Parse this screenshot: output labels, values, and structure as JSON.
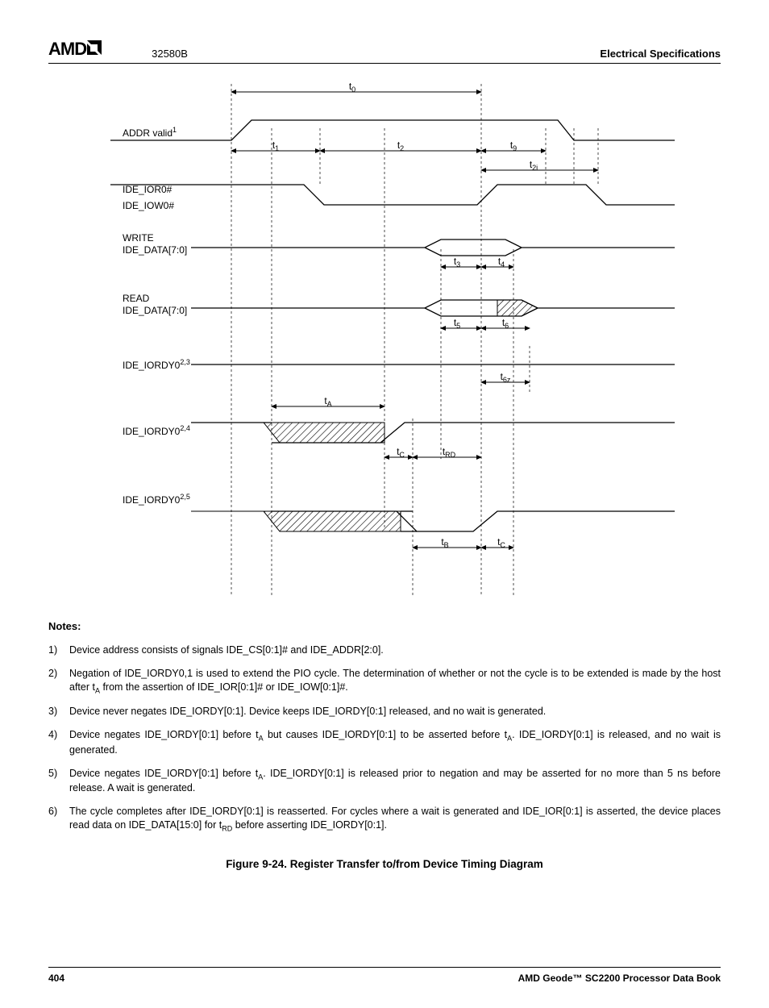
{
  "header": {
    "logo_text": "AMD",
    "doc_id": "32580B",
    "section": "Electrical Specifications"
  },
  "diagram": {
    "signals": {
      "addr": "ADDR valid",
      "addr_sup": "1",
      "ior": "IDE_IOR0#",
      "iow": "IDE_IOW0#",
      "write": "WRITE",
      "write_data": "IDE_DATA[7:0]",
      "read": "READ",
      "read_data": "IDE_DATA[7:0]",
      "iordy1": "IDE_IORDY0",
      "iordy1_sup": "2,3",
      "iordy2": "IDE_IORDY0",
      "iordy2_sup": "2,4",
      "iordy3": "IDE_IORDY0",
      "iordy3_sup": "2,5"
    },
    "timings": {
      "t0": "t0",
      "t1": "t1",
      "t2": "t2",
      "t9": "t9",
      "t2i": "t2i",
      "t3": "t3",
      "t4": "t4",
      "t5": "t5",
      "t6": "t6",
      "t6z": "t6z",
      "tA": "tA",
      "tC": "tC",
      "tRD": "tRD",
      "tB": "tB",
      "tC2": "tC"
    }
  },
  "notes": {
    "title": "Notes:",
    "items": [
      {
        "n": "1)",
        "text": "Device address consists of signals IDE_CS[0:1]# and IDE_ADDR[2:0]."
      },
      {
        "n": "2)",
        "text": "Negation of IDE_IORDY0,1 is used to extend the PIO cycle. The determination of whether or not the cycle is to be extended is made by the host after t",
        "sub": "A",
        "text2": " from the assertion of IDE_IOR[0:1]# or IDE_IOW[0:1]#."
      },
      {
        "n": "3)",
        "text": "Device never negates IDE_IORDY[0:1]. Device keeps IDE_IORDY[0:1] released, and no wait is generated."
      },
      {
        "n": "4)",
        "text": "Device negates IDE_IORDY[0:1] before t",
        "sub": "A",
        "text2": " but causes IDE_IORDY[0:1] to be asserted before t",
        "sub2": "A",
        "text3": ". IDE_IORDY[0:1] is released, and no wait is generated."
      },
      {
        "n": "5)",
        "text": "Device negates IDE_IORDY[0:1] before t",
        "sub": "A",
        "text2": ". IDE_IORDY[0:1] is released prior to negation and may be asserted for no more than 5 ns before release. A wait is generated."
      },
      {
        "n": "6)",
        "text": "The cycle completes after IDE_IORDY[0:1] is reasserted. For cycles where a wait is generated and IDE_IOR[0:1] is asserted, the device places read data on IDE_DATA[15:0] for t",
        "sub": "RD",
        "text2": " before asserting IDE_IORDY[0:1]."
      }
    ]
  },
  "figure_caption": "Figure 9-24.  Register Transfer to/from Device Timing Diagram",
  "footer": {
    "page": "404",
    "book": "AMD Geode™ SC2200  Processor Data Book"
  }
}
